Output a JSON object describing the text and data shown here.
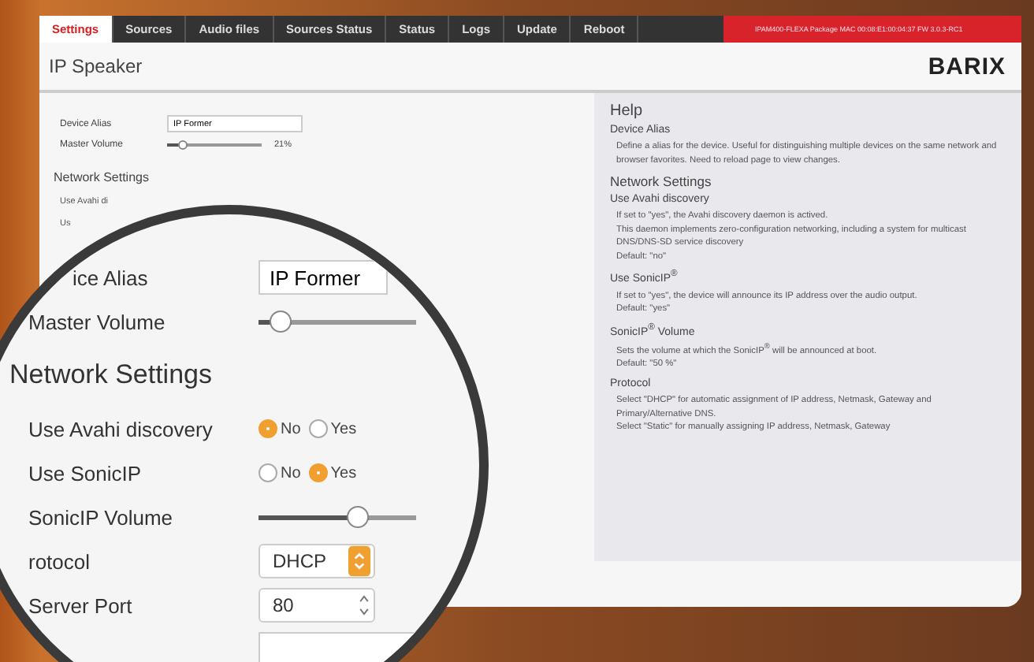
{
  "tabs": [
    {
      "label": "Settings",
      "selected": true
    },
    {
      "label": "Sources",
      "selected": false
    },
    {
      "label": "Audio files",
      "selected": false
    },
    {
      "label": "Sources Status",
      "selected": false
    },
    {
      "label": "Status",
      "selected": false
    },
    {
      "label": "Logs",
      "selected": false
    },
    {
      "label": "Update",
      "selected": false
    },
    {
      "label": "Reboot",
      "selected": false
    }
  ],
  "device_info": "IPAM400-FLEXA Package MAC 00:08:E1:00:04:37 FW 3.0.3-RC1",
  "page_title": "IP Speaker",
  "logo": "BARIX",
  "form": {
    "device_alias": {
      "label": "Device Alias",
      "value": "IP Former"
    },
    "master_volume": {
      "label": "Master Volume",
      "level": 0.21,
      "reading": "21%"
    },
    "section": "Network Settings",
    "cut_rows": [
      "Use Avahi di",
      "Us"
    ]
  },
  "magnifier": {
    "rows": [
      {
        "kind": "text",
        "label": "ice Alias",
        "value": "IP Former"
      },
      {
        "kind": "slider",
        "label": "Master Volume",
        "level": 0.21
      },
      {
        "kind": "heading",
        "label": "Network Settings"
      },
      {
        "kind": "radio",
        "label": "Use Avahi discovery",
        "options": [
          {
            "label": "No",
            "selected": true
          },
          {
            "label": "Yes",
            "selected": false
          }
        ]
      },
      {
        "kind": "radio",
        "label": "Use SonicIP",
        "options": [
          {
            "label": "No",
            "selected": false
          },
          {
            "label": "Yes",
            "selected": true
          }
        ]
      },
      {
        "kind": "slider",
        "label": "SonicIP Volume",
        "level": 0.7
      },
      {
        "kind": "select",
        "label": "rotocol",
        "value": "DHCP"
      },
      {
        "kind": "number",
        "label": "Server Port",
        "value": "80"
      },
      {
        "kind": "blank"
      }
    ]
  },
  "help": {
    "title": "Help",
    "items": [
      {
        "kind": "section",
        "text": "Device Alias"
      },
      {
        "kind": "body",
        "lines": [
          "Define a alias for the device. Useful for distinguishing multiple devices on the same network and browser favorites. Need to reload page to view changes."
        ]
      },
      {
        "kind": "group",
        "text": "Network Settings"
      },
      {
        "kind": "section",
        "text": "Use Avahi discovery"
      },
      {
        "kind": "body",
        "lines": [
          "If set to \"yes\", the Avahi discovery daemon is actived.",
          "This daemon implements zero-configuration networking, including a system for multicast DNS/DNS-SD service discovery",
          "Default: \"no\""
        ]
      },
      {
        "kind": "section",
        "text": "Use SonicIP$^{®}$"
      },
      {
        "kind": "body",
        "lines": [
          "If set to \"yes\", the device will announce its IP address over the audio output.",
          "Default: \"yes\""
        ]
      },
      {
        "kind": "section",
        "text": "SonicIP$^{®}$ Volume"
      },
      {
        "kind": "body",
        "lines": [
          "Sets the volume at which the SonicIP$^{®}$ will be announced at boot.",
          "Default: \"50 %\""
        ]
      },
      {
        "kind": "section",
        "text": "Protocol"
      },
      {
        "kind": "body",
        "lines": [
          "Select \"DHCP\" for automatic assignment of IP address, Netmask, Gateway and Primary/Alternative DNS.",
          "Select \"Static\" for manually assigning IP address, Netmask, Gateway"
        ]
      }
    ]
  }
}
